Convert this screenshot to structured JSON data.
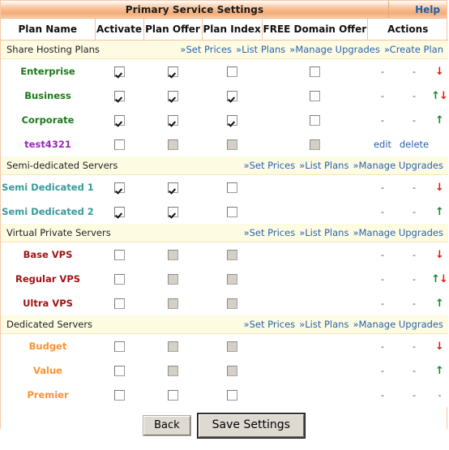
{
  "titlebar": {
    "title": "Primary Service Settings",
    "help_label": "Help"
  },
  "columns": {
    "plan_name": "Plan Name",
    "activate": "Activate",
    "plan_offer": "Plan Offer",
    "plan_index": "Plan Index",
    "free_domain_offer": "FREE Domain Offer",
    "actions": "Actions"
  },
  "colors": {
    "accent": "#f4ab76",
    "link": "#2a61ad",
    "arrow_up": "#108a21",
    "arrow_down": "#e01b12",
    "section_bg": "#fdfce3",
    "shared_plan_name": "#1a7a1a",
    "semi_plan_name": "#3a9a9a",
    "vps_plan_name": "#9c1414",
    "dedicated_plan_name": "#fb9430",
    "custom_plan_name": "#9b26b6"
  },
  "sections": [
    {
      "label": "Share Hosting Plans",
      "links": [
        "»Set Prices",
        "»List Plans",
        "»Manage Upgrades",
        "»Create Plan"
      ],
      "name_color": "#1a7a1a",
      "rows": [
        {
          "name": "Enterprise",
          "activate": {
            "checked": true,
            "disabled": false
          },
          "plan_offer": {
            "checked": true,
            "disabled": false
          },
          "plan_index": {
            "checked": false,
            "disabled": false
          },
          "free_domain_offer": {
            "checked": false,
            "disabled": false
          },
          "action1": "-",
          "action2": "-",
          "arrows": [
            "down"
          ]
        },
        {
          "name": "Business",
          "activate": {
            "checked": true,
            "disabled": false
          },
          "plan_offer": {
            "checked": true,
            "disabled": false
          },
          "plan_index": {
            "checked": true,
            "disabled": false
          },
          "free_domain_offer": {
            "checked": false,
            "disabled": false
          },
          "action1": "-",
          "action2": "-",
          "arrows": [
            "up",
            "down"
          ]
        },
        {
          "name": "Corporate",
          "activate": {
            "checked": true,
            "disabled": false
          },
          "plan_offer": {
            "checked": true,
            "disabled": false
          },
          "plan_index": {
            "checked": true,
            "disabled": false
          },
          "free_domain_offer": {
            "checked": false,
            "disabled": false
          },
          "action1": "-",
          "action2": "-",
          "arrows": [
            "up"
          ]
        },
        {
          "name": "test4321",
          "name_color": "#9b26b6",
          "activate": {
            "checked": false,
            "disabled": false
          },
          "plan_offer": {
            "checked": false,
            "disabled": true
          },
          "plan_index": {
            "checked": false,
            "disabled": true
          },
          "free_domain_offer": {
            "checked": false,
            "disabled": true
          },
          "action1": "edit",
          "action2": "delete",
          "action1_link": true,
          "action2_link": true,
          "arrows": []
        }
      ]
    },
    {
      "label": "Semi-dedicated Servers",
      "links": [
        "»Set Prices",
        "»List Plans",
        "»Manage Upgrades"
      ],
      "name_color": "#3a9a9a",
      "rows": [
        {
          "name": "Semi Dedicated 1",
          "activate": {
            "checked": true,
            "disabled": false
          },
          "plan_offer": {
            "checked": true,
            "disabled": false
          },
          "plan_index": {
            "checked": false,
            "disabled": false
          },
          "free_domain_offer": null,
          "action1": "-",
          "action2": "-",
          "arrows": [
            "down"
          ]
        },
        {
          "name": "Semi Dedicated 2",
          "activate": {
            "checked": true,
            "disabled": false
          },
          "plan_offer": {
            "checked": true,
            "disabled": false
          },
          "plan_index": {
            "checked": false,
            "disabled": false
          },
          "free_domain_offer": null,
          "action1": "-",
          "action2": "-",
          "arrows": [
            "up"
          ]
        }
      ]
    },
    {
      "label": "Virtual Private Servers",
      "links": [
        "»Set Prices",
        "»List Plans",
        "»Manage Upgrades"
      ],
      "name_color": "#9c1414",
      "rows": [
        {
          "name": "Base VPS",
          "activate": {
            "checked": false,
            "disabled": false
          },
          "plan_offer": {
            "checked": false,
            "disabled": true
          },
          "plan_index": {
            "checked": false,
            "disabled": true
          },
          "free_domain_offer": null,
          "action1": "-",
          "action2": "-",
          "arrows": [
            "down"
          ]
        },
        {
          "name": "Regular VPS",
          "activate": {
            "checked": false,
            "disabled": false
          },
          "plan_offer": {
            "checked": false,
            "disabled": true
          },
          "plan_index": {
            "checked": false,
            "disabled": true
          },
          "free_domain_offer": null,
          "action1": "-",
          "action2": "-",
          "arrows": [
            "up",
            "down"
          ]
        },
        {
          "name": "Ultra VPS",
          "activate": {
            "checked": false,
            "disabled": false
          },
          "plan_offer": {
            "checked": false,
            "disabled": true
          },
          "plan_index": {
            "checked": false,
            "disabled": true
          },
          "free_domain_offer": null,
          "action1": "-",
          "action2": "-",
          "arrows": [
            "up"
          ]
        }
      ]
    },
    {
      "label": "Dedicated Servers",
      "links": [
        "»Set Prices",
        "»List Plans",
        "»Manage Upgrades"
      ],
      "name_color": "#fb9430",
      "rows": [
        {
          "name": "Budget",
          "activate": {
            "checked": false,
            "disabled": false
          },
          "plan_offer": {
            "checked": false,
            "disabled": true
          },
          "plan_index": {
            "checked": false,
            "disabled": true
          },
          "free_domain_offer": null,
          "action1": "-",
          "action2": "-",
          "arrows": [
            "down"
          ]
        },
        {
          "name": "Value",
          "activate": {
            "checked": false,
            "disabled": false
          },
          "plan_offer": {
            "checked": false,
            "disabled": true
          },
          "plan_index": {
            "checked": false,
            "disabled": true
          },
          "free_domain_offer": null,
          "action1": "-",
          "action2": "-",
          "arrows": [
            "up"
          ]
        },
        {
          "name": "Premier",
          "activate": {
            "checked": false,
            "disabled": false
          },
          "plan_offer": {
            "checked": false,
            "disabled": false
          },
          "plan_index": {
            "checked": false,
            "disabled": false
          },
          "free_domain_offer": null,
          "action1": "-",
          "action2": "-",
          "arrows": [
            "dash"
          ]
        }
      ]
    }
  ],
  "footer": {
    "back_label": "Back",
    "save_label": "Save Settings"
  }
}
